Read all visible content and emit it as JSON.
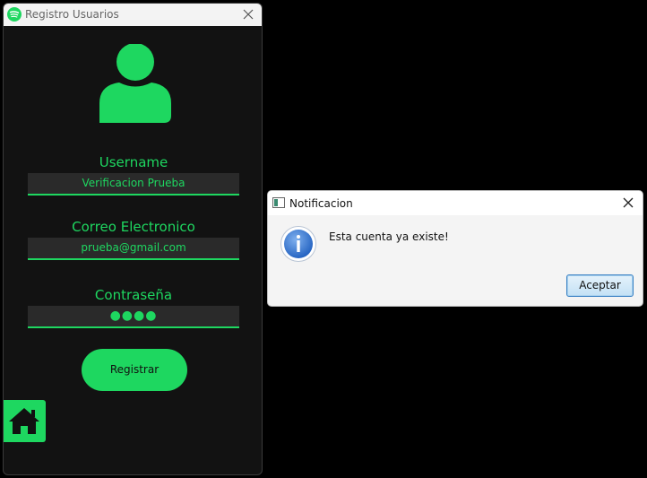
{
  "main_window": {
    "title": "Registro Usuarios",
    "form": {
      "username_label": "Username",
      "username_value": "Verificacion Prueba",
      "email_label": "Correo Electronico",
      "email_value": "prueba@gmail.com",
      "password_label": "Contraseña",
      "password_value": "●●●●",
      "register_label": "Registrar"
    },
    "icons": [
      "spotify-icon",
      "close-icon",
      "user-avatar-icon",
      "home-icon"
    ],
    "accent_color": "#1ed760",
    "background_color": "#121212"
  },
  "dialog": {
    "title": "Notificacion",
    "message": "Esta cuenta ya existe!",
    "accept_label": "Aceptar",
    "icons": [
      "window-icon",
      "close-icon",
      "info-icon"
    ]
  }
}
